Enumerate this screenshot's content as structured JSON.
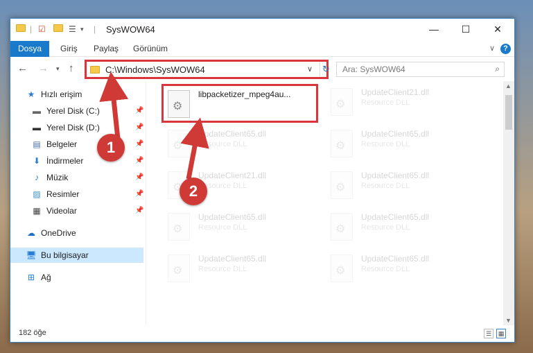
{
  "window": {
    "title": "SysWOW64",
    "accent": "#1979ca"
  },
  "ribbon": {
    "tabs": [
      "Dosya",
      "Giriş",
      "Paylaş",
      "Görünüm"
    ],
    "help_label": "?"
  },
  "nav": {
    "address": "C:\\Windows\\SysWOW64",
    "search_placeholder": "Ara: SysWOW64"
  },
  "sidebar": {
    "items": [
      {
        "label": "Hızlı erişim",
        "icon": "star-icon",
        "pinned": false
      },
      {
        "label": "Yerel Disk (C:)",
        "icon": "drive-icon",
        "pinned": true
      },
      {
        "label": "Yerel Disk (D:)",
        "icon": "drive-icon",
        "pinned": true
      },
      {
        "label": "Belgeler",
        "icon": "documents-icon",
        "pinned": true
      },
      {
        "label": "İndirmeler",
        "icon": "download-icon",
        "pinned": true
      },
      {
        "label": "Müzik",
        "icon": "music-icon",
        "pinned": true
      },
      {
        "label": "Resimler",
        "icon": "pictures-icon",
        "pinned": true
      },
      {
        "label": "Videolar",
        "icon": "videos-icon",
        "pinned": true
      },
      {
        "label": "OneDrive",
        "icon": "cloud-icon",
        "pinned": false
      },
      {
        "label": "Bu bilgisayar",
        "icon": "computer-icon",
        "pinned": false,
        "selected": true
      },
      {
        "label": "Ağ",
        "icon": "network-icon",
        "pinned": false
      }
    ]
  },
  "files": [
    {
      "name": "libpacketizer_mpeg4au...",
      "type": ""
    },
    {
      "name": "UpdateClient21.dll",
      "type": "Resource DLL"
    },
    {
      "name": "UpdateClient65.dll",
      "type": "Resource DLL"
    },
    {
      "name": "UpdateClient65.dll",
      "type": "Resource DLL"
    },
    {
      "name": "UpdateClient21.dll",
      "type": "Resource DLL"
    },
    {
      "name": "UpdateClient65.dll",
      "type": "Resource DLL"
    },
    {
      "name": "UpdateClient65.dll",
      "type": "Resource DLL"
    },
    {
      "name": "UpdateClient65.dll",
      "type": "Resource DLL"
    },
    {
      "name": "UpdateClient65.dll",
      "type": "Resource DLL"
    },
    {
      "name": "UpdateClient65.dll",
      "type": "Resource DLL"
    }
  ],
  "status": {
    "item_count": "182 öğe"
  },
  "callouts": {
    "one": "1",
    "two": "2",
    "color": "#cf3a37"
  }
}
